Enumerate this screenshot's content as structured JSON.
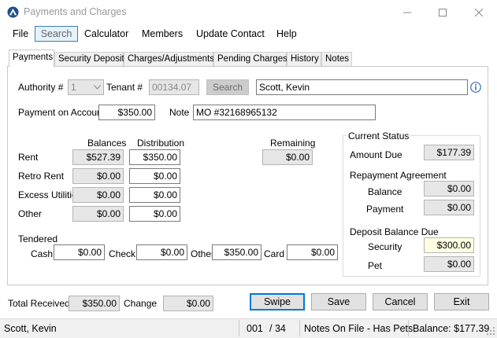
{
  "window": {
    "title": "Payments and Charges"
  },
  "menu": {
    "file": "File",
    "search": "Search",
    "calculator": "Calculator",
    "members": "Members",
    "update_contact": "Update Contact",
    "help": "Help"
  },
  "tabs": [
    "Payments",
    "Security Deposit",
    "Charges/Adjustments",
    "Pending Charges",
    "History",
    "Notes"
  ],
  "header": {
    "authority_label": "Authority #",
    "authority_value": "1",
    "tenant_label": "Tenant #",
    "tenant_value": "00134.07",
    "search_button": "Search",
    "tenant_name": "Scott, Kevin"
  },
  "payment": {
    "label": "Payment on Account",
    "value": "$350.00",
    "note_label": "Note",
    "note_value": "MO #32168965132"
  },
  "grid": {
    "balances_header": "Balances",
    "distribution_header": "Distribution",
    "remaining_header": "Remaining",
    "remaining_value": "$0.00",
    "rows": [
      {
        "label": "Rent",
        "balance": "$527.39",
        "distribution": "$350.00"
      },
      {
        "label": "Retro Rent",
        "balance": "$0.00",
        "distribution": "$0.00"
      },
      {
        "label": "Excess Utilities",
        "balance": "$0.00",
        "distribution": "$0.00"
      },
      {
        "label": "Other",
        "balance": "$0.00",
        "distribution": "$0.00"
      }
    ]
  },
  "tendered": {
    "label": "Tendered",
    "cash_label": "Cash",
    "cash_value": "$0.00",
    "check_label": "Check",
    "check_value": "$0.00",
    "other_label": "Other",
    "other_value": "$350.00",
    "card_label": "Card",
    "card_value": "$0.00"
  },
  "status": {
    "title": "Current Status",
    "amount_due_label": "Amount Due",
    "amount_due_value": "$177.39",
    "repayment_label": "Repayment Agreement",
    "balance_label": "Balance",
    "balance_value": "$0.00",
    "payment_label": "Payment",
    "payment_value": "$0.00",
    "deposit_label": "Deposit Balance Due",
    "security_label": "Security",
    "security_value": "$300.00",
    "pet_label": "Pet",
    "pet_value": "$0.00"
  },
  "footer": {
    "total_received_label": "Total Received",
    "total_received_value": "$350.00",
    "change_label": "Change",
    "change_value": "$0.00",
    "swipe": "Swipe",
    "save": "Save",
    "cancel": "Cancel",
    "exit": "Exit"
  },
  "statusbar": {
    "name": "Scott, Kevin",
    "record": "001",
    "total": "/ 34",
    "notes": "Notes On File - Has Pets",
    "balance": "Balance: $177.39"
  },
  "colors": {
    "accent": "#0078d7",
    "readonly_bg": "#e6e6e6",
    "highlight_bg": "#ffffe1"
  },
  "icons": [
    "app-logo-icon",
    "minimize-icon",
    "maximize-icon",
    "close-icon",
    "chevron-down-icon",
    "info-icon"
  ]
}
